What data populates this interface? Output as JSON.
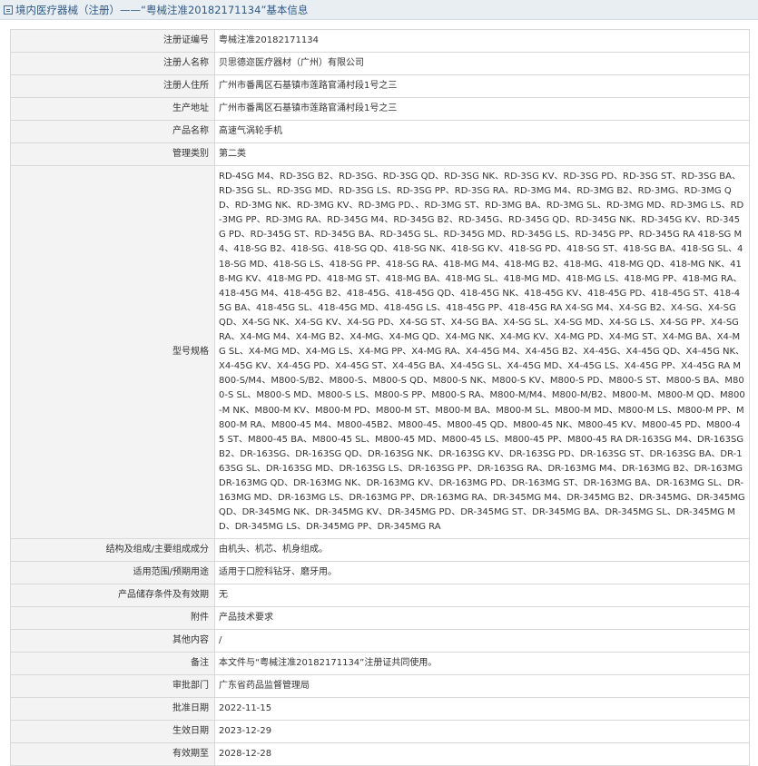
{
  "header": {
    "title": "境内医疗器械（注册）——“粤械注准20182171134”基本信息",
    "icon": "document-icon"
  },
  "rows": [
    {
      "label": "注册证编号",
      "value": "粤械注准20182171134"
    },
    {
      "label": "注册人名称",
      "value": "贝思德迩医疗器材（广州）有限公司"
    },
    {
      "label": "注册人住所",
      "value": "广州市番禺区石基镇市莲路官涌村段1号之三"
    },
    {
      "label": "生产地址",
      "value": "广州市番禺区石基镇市莲路官涌村段1号之三"
    },
    {
      "label": "产品名称",
      "value": "高速气涡轮手机"
    },
    {
      "label": "管理类别",
      "value": "第二类"
    },
    {
      "label": "型号规格",
      "value": "RD-4SG M4、RD-3SG B2、RD-3SG、RD-3SG QD、RD-3SG NK、RD-3SG KV、RD-3SG PD、RD-3SG ST、RD-3SG BA、RD-3SG SL、RD-3SG MD、RD-3SG LS、RD-3SG PP、RD-3SG RA、RD-3MG M4、RD-3MG B2、RD-3MG、RD-3MG QD、RD-3MG NK、RD-3MG KV、RD-3MG PD、、RD-3MG ST、RD-3MG BA、RD-3MG SL、RD-3MG MD、RD-3MG LS、RD-3MG PP、RD-3MG RA、RD-345G M4、RD-345G B2、RD-345G、RD-345G QD、RD-345G NK、RD-345G KV、RD-345G PD、RD-345G ST、RD-345G BA、RD-345G SL、RD-345G MD、RD-345G LS、RD-345G PP、RD-345G RA 418-SG M4、418-SG B2、418-SG、418-SG QD、418-SG NK、418-SG KV、418-SG PD、418-SG ST、418-SG BA、418-SG SL、418-SG MD、418-SG LS、418-SG PP、418-SG RA、418-MG M4、418-MG B2、418-MG、418-MG QD、418-MG NK、418-MG KV、418-MG PD、418-MG ST、418-MG BA、418-MG SL、418-MG MD、418-MG LS、418-MG PP、418-MG RA、418-45G M4、418-45G B2、418-45G、418-45G QD、418-45G NK、418-45G KV、418-45G PD、418-45G ST、418-45G BA、418-45G SL、418-45G MD、418-45G LS、418-45G PP、418-45G RA X4-SG M4、X4-SG B2、X4-SG、X4-SG QD、X4-SG NK、X4-SG KV、X4-SG PD、X4-SG ST、X4-SG BA、X4-SG SL、X4-SG MD、X4-SG LS、X4-SG PP、X4-SG RA、X4-MG M4、X4-MG B2、X4-MG、X4-MG QD、X4-MG NK、X4-MG KV、X4-MG PD、X4-MG ST、X4-MG BA、X4-MG SL、X4-MG MD、X4-MG LS、X4-MG PP、X4-MG RA、X4-45G M4、X4-45G B2、X4-45G、X4-45G QD、X4-45G NK、X4-45G KV、X4-45G PD、X4-45G ST、X4-45G BA、X4-45G SL、X4-45G MD、X4-45G LS、X4-45G PP、X4-45G RA M800-S/M4、M800-S/B2、M800-S、M800-S QD、M800-S NK、M800-S KV、M800-S PD、M800-S ST、M800-S BA、M800-S SL、M800-S MD、M800-S LS、M800-S PP、M800-S RA、M800-M/M4、M800-M/B2、M800-M、M800-M QD、M800-M NK、M800-M KV、M800-M PD、M800-M ST、M800-M BA、M800-M SL、M800-M MD、M800-M LS、M800-M PP、M800-M RA、M800-45 M4、M800-45B2、M800-45、M800-45 QD、M800-45 NK、M800-45 KV、M800-45 PD、M800-45 ST、M800-45 BA、M800-45 SL、M800-45 MD、M800-45 LS、M800-45 PP、M800-45 RA DR-163SG M4、DR-163SG B2、DR-163SG、DR-163SG QD、DR-163SG NK、DR-163SG KV、DR-163SG PD、DR-163SG ST、DR-163SG BA、DR-163SG SL、DR-163SG MD、DR-163SG LS、DR-163SG PP、DR-163SG RA、DR-163MG M4、DR-163MG B2、DR-163MGDR-163MG QD、DR-163MG NK、DR-163MG KV、DR-163MG PD、DR-163MG ST、DR-163MG BA、DR-163MG SL、DR-163MG MD、DR-163MG LS、DR-163MG PP、DR-163MG RA、DR-345MG M4、DR-345MG B2、DR-345MG、DR-345MG QD、DR-345MG NK、DR-345MG KV、DR-345MG PD、DR-345MG ST、DR-345MG BA、DR-345MG SL、DR-345MG MD、DR-345MG LS、DR-345MG PP、DR-345MG RA"
    },
    {
      "label": "结构及组成/主要组成成分",
      "value": "由机头、机芯、机身组成。"
    },
    {
      "label": "适用范围/预期用途",
      "value": "适用于口腔科钻牙、磨牙用。"
    },
    {
      "label": "产品储存条件及有效期",
      "value": "无"
    },
    {
      "label": "附件",
      "value": "产品技术要求"
    },
    {
      "label": "其他内容",
      "value": "/"
    },
    {
      "label": "备注",
      "value": "本文件与“粤械注准20182171134”注册证共同使用。"
    },
    {
      "label": "审批部门",
      "value": "广东省药品监督管理局"
    },
    {
      "label": "批准日期",
      "value": "2022-11-15"
    },
    {
      "label": "生效日期",
      "value": "2023-12-29"
    },
    {
      "label": "有效期至",
      "value": "2028-12-28"
    }
  ]
}
